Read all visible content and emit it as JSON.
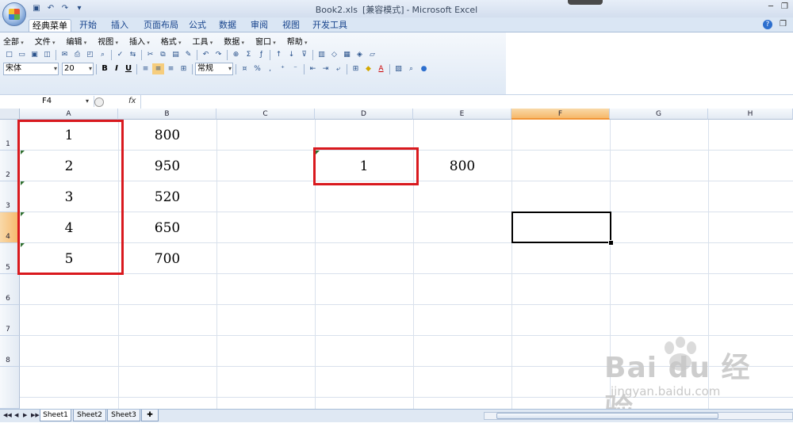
{
  "window": {
    "file_name": "Book2.xls",
    "mode": "[兼容模式]",
    "app_name": "Microsoft Excel"
  },
  "tabs": [
    "经典菜单",
    "开始",
    "插入",
    "页面布局",
    "公式",
    "数据",
    "审阅",
    "视图",
    "开发工具"
  ],
  "menu": [
    "全部",
    "文件",
    "编辑",
    "视图",
    "插入",
    "格式",
    "工具",
    "数据",
    "窗口",
    "帮助"
  ],
  "toolbar": {
    "font_name": "宋体",
    "font_size": "20",
    "bold": "B",
    "italic": "I",
    "underline": "U",
    "number_format": "常规",
    "percent": "%",
    "comma": ","
  },
  "formula_bar": {
    "name_box": "F4",
    "fx_label": "fx",
    "formula": ""
  },
  "grid": {
    "columns": [
      "A",
      "B",
      "C",
      "D",
      "E",
      "F",
      "G",
      "H"
    ],
    "rows": [
      "1",
      "2",
      "3",
      "4",
      "5",
      "6",
      "7",
      "8"
    ],
    "selected_column": "F",
    "selected_row": "4",
    "cells": {
      "A1": "1",
      "A2": "2",
      "A3": "3",
      "A4": "4",
      "A5": "5",
      "B1": "800",
      "B2": "950",
      "B3": "520",
      "B4": "650",
      "B5": "700",
      "D2": "1",
      "E2": "800"
    }
  },
  "sheets": [
    "Sheet1",
    "Sheet2",
    "Sheet3"
  ],
  "active_sheet": "Sheet1",
  "watermark": {
    "brand": "Bai du 经验",
    "url": "jingyan.baidu.com"
  },
  "colors": {
    "highlight_red": "#d9191e",
    "header_selected": "#f6b86a",
    "ribbon_blue": "#dae6f4"
  }
}
